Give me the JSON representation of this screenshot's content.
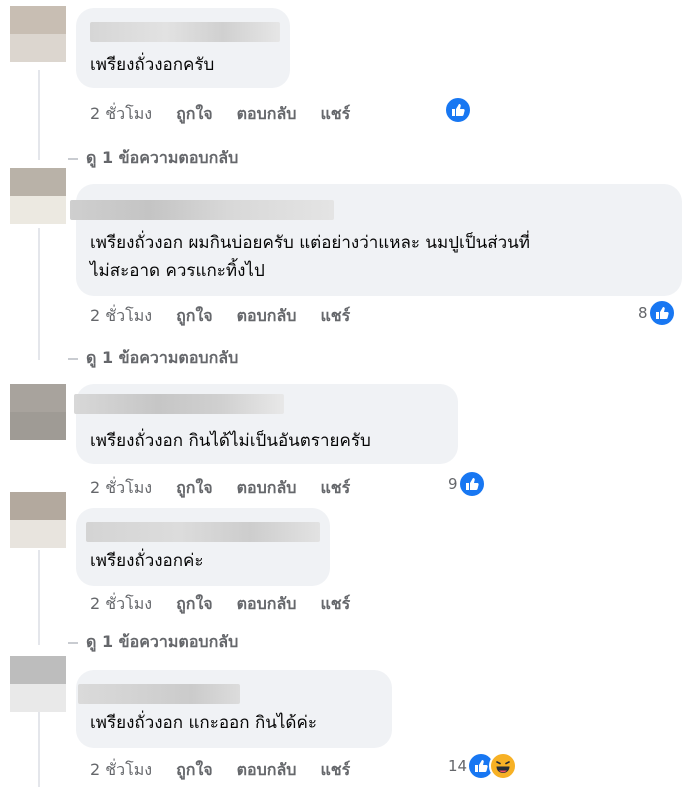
{
  "comments": [
    {
      "text": [
        "เพรียงถั่วงอกครับ"
      ],
      "time": "2 ชั่วโมง",
      "like": "ถูกใจ",
      "reply": "ตอบกลับ",
      "share": "แชร์",
      "reaction_count": "",
      "view_replies": "ดู 1 ข้อความตอบกลับ"
    },
    {
      "text": [
        "เพรียงถั่วงอก ผมกินบ่อยครับ แต่อย่างว่าแหละ นมปูเป็นส่วนที่",
        "ไม่สะอาด ควรแกะทิ้งไป"
      ],
      "time": "2 ชั่วโมง",
      "like": "ถูกใจ",
      "reply": "ตอบกลับ",
      "share": "แชร์",
      "reaction_count": "8",
      "view_replies": "ดู 1 ข้อความตอบกลับ"
    },
    {
      "text": [
        "เพรียงถั่วงอก กินได้ไม่เป็นอันตรายครับ"
      ],
      "time": "2 ชั่วโมง",
      "like": "ถูกใจ",
      "reply": "ตอบกลับ",
      "share": "แชร์",
      "reaction_count": "9",
      "view_replies": ""
    },
    {
      "text": [
        "เพรียงถั่วงอกค่ะ"
      ],
      "time": "2 ชั่วโมง",
      "like": "ถูกใจ",
      "reply": "ตอบกลับ",
      "share": "แชร์",
      "reaction_count": "",
      "view_replies": "ดู 1 ข้อความตอบกลับ"
    },
    {
      "text": [
        "เพรียงถั่วงอก แกะออก กินได้ค่ะ"
      ],
      "time": "2 ชั่วโมง",
      "like": "ถูกใจ",
      "reply": "ตอบกลับ",
      "share": "แชร์",
      "reaction_count": "14",
      "view_replies": ""
    }
  ],
  "colors": {
    "bubble": "#f0f2f5",
    "meta": "#65676b",
    "like_blue": "#1877f2",
    "haha_yellow": "#f7b125"
  },
  "icons": [
    "like-icon",
    "haha-icon"
  ]
}
